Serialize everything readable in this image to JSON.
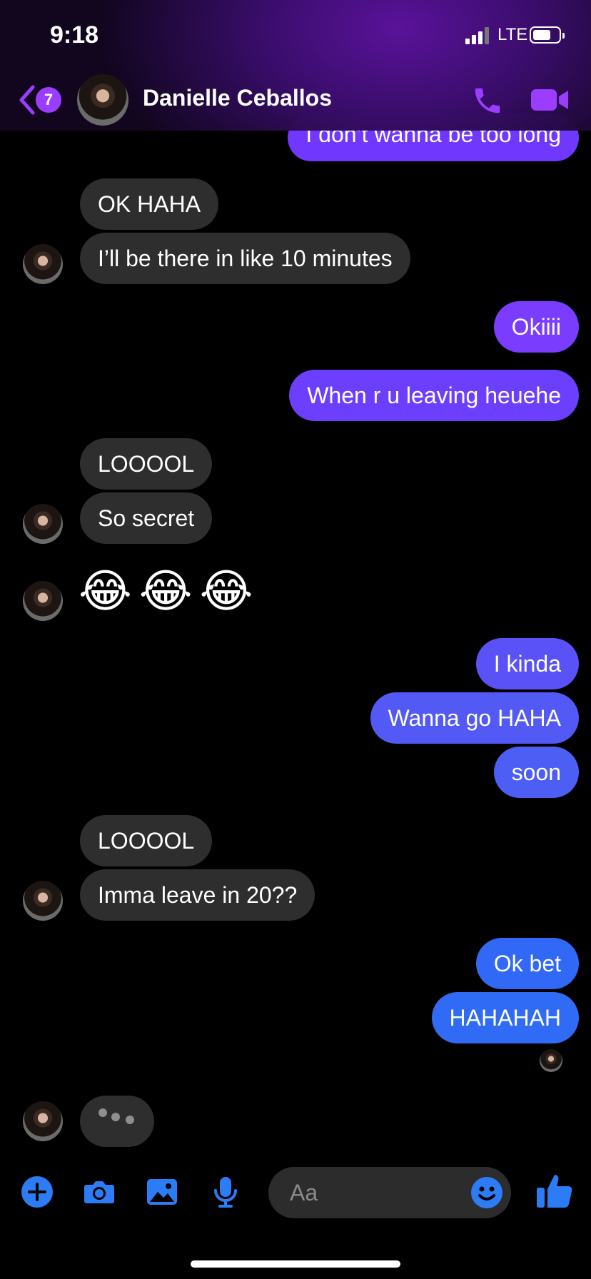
{
  "status": {
    "time": "9:18",
    "network": "LTE",
    "battery_level": 0.7
  },
  "header": {
    "back_count": "7",
    "contact_name": "Danielle Ceballos"
  },
  "messages": {
    "m0": "I don’t wanna be too long",
    "m1": "OK HAHA",
    "m2": "I’ll be there in like 10 minutes",
    "m3": "Okiiii",
    "m4": "When r u leaving heuehe",
    "m5": "LOOOOL",
    "m6": "So secret",
    "m7": "😂😂😂",
    "m8": "I kinda",
    "m9": "Wanna go HAHA",
    "m10": "soon",
    "m11": "LOOOOL",
    "m12": "Imma leave in 20??",
    "m13": "Ok bet",
    "m14": "HAHAHAH"
  },
  "composer": {
    "placeholder": "Aa"
  },
  "colors": {
    "accent": "#9b3dff",
    "incoming": "#2e2e2e",
    "out_purple": "#7038ff",
    "out_indigo": "#5359f5",
    "out_blue": "#2f6bf5",
    "toolbar_blue": "#2c7cf6"
  },
  "icons": {
    "back": "chevron-left-icon",
    "phone": "phone-icon",
    "video": "video-camera-icon",
    "add": "plus-circle-icon",
    "camera": "camera-icon",
    "gallery": "photo-icon",
    "mic": "microphone-icon",
    "emoji": "smiley-icon",
    "like": "thumbs-up-icon"
  }
}
